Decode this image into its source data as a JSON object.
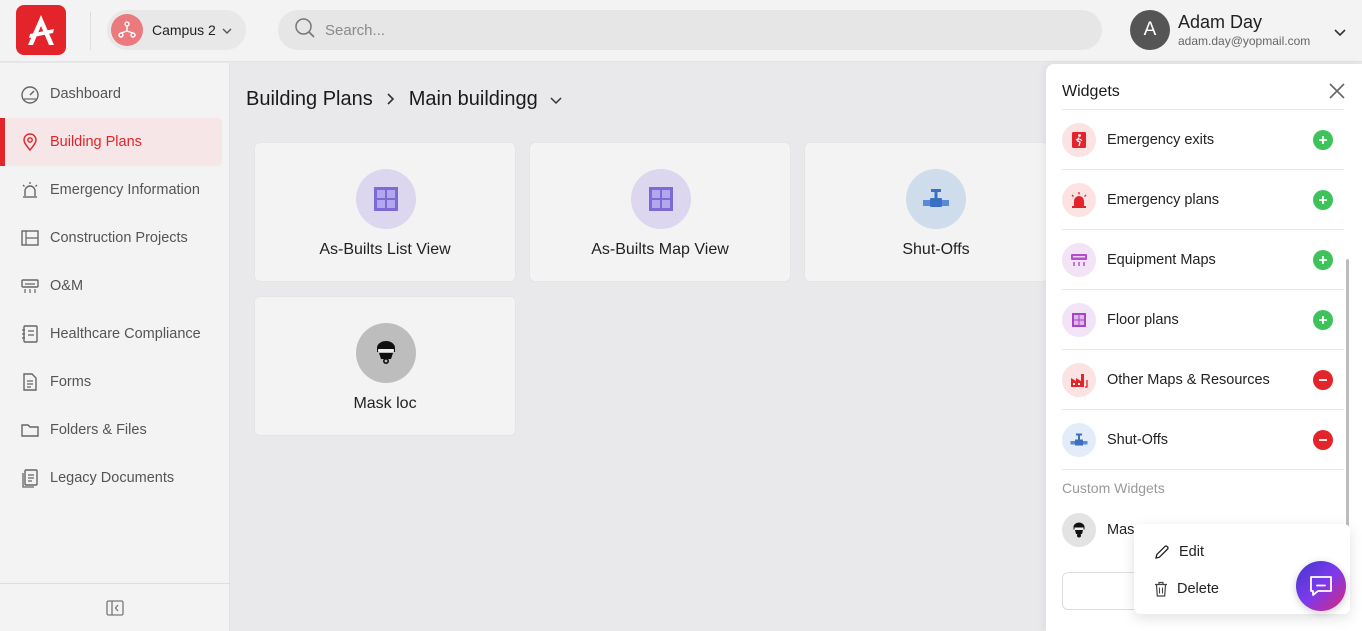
{
  "header": {
    "campus_label": "Campus 2",
    "search_placeholder": "Search...",
    "user": {
      "initial": "A",
      "name": "Adam Day",
      "email": "adam.day@yopmail.com"
    }
  },
  "sidebar": {
    "items": [
      {
        "label": "Dashboard",
        "icon": "gauge-icon",
        "active": false
      },
      {
        "label": "Building Plans",
        "icon": "map-pin-icon",
        "active": true
      },
      {
        "label": "Emergency Information",
        "icon": "siren-icon",
        "active": false
      },
      {
        "label": "Construction Projects",
        "icon": "blueprint-icon",
        "active": false
      },
      {
        "label": "O&M",
        "icon": "hvac-icon",
        "active": false
      },
      {
        "label": "Healthcare Compliance",
        "icon": "notebook-icon",
        "active": false
      },
      {
        "label": "Forms",
        "icon": "form-icon",
        "active": false
      },
      {
        "label": "Folders & Files",
        "icon": "folder-icon",
        "active": false
      },
      {
        "label": "Legacy Documents",
        "icon": "documents-icon",
        "active": false
      }
    ]
  },
  "breadcrumb": {
    "root": "Building Plans",
    "current": "Main buildingg"
  },
  "cards": [
    {
      "title": "As-Builts List View",
      "icon": "floorplan-icon"
    },
    {
      "title": "As-Builts Map View",
      "icon": "floorplan-icon"
    },
    {
      "title": "Shut-Offs",
      "icon": "valve-icon"
    },
    {
      "title": "Mask loc",
      "icon": "mask-icon"
    }
  ],
  "widgets": {
    "title": "Widgets",
    "items": [
      {
        "label": "Emergency exits",
        "icon": "exit-icon",
        "action": "add"
      },
      {
        "label": "Emergency plans",
        "icon": "siren-icon",
        "action": "add"
      },
      {
        "label": "Equipment Maps",
        "icon": "equipment-icon",
        "action": "add"
      },
      {
        "label": "Floor plans",
        "icon": "floorplan-icon",
        "action": "add"
      },
      {
        "label": "Other Maps & Resources",
        "icon": "factory-icon",
        "action": "remove"
      },
      {
        "label": "Shut-Offs",
        "icon": "valve-icon",
        "action": "remove"
      }
    ],
    "custom_label": "Custom Widgets",
    "custom_items": [
      {
        "label": "Mas",
        "icon": "mask-icon"
      }
    ]
  },
  "context_menu": {
    "edit": "Edit",
    "delete": "Delete"
  },
  "colors": {
    "brand": "#e3242b",
    "add": "#3ec35a",
    "remove": "#e3242b"
  }
}
